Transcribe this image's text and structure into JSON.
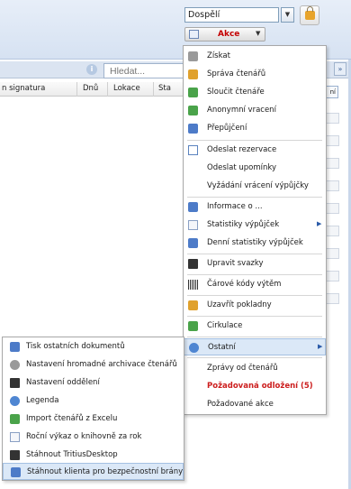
{
  "header": {
    "age_select_value": "Dospělí",
    "actions_button_label": "Akce",
    "actions_button_color": "#c40000"
  },
  "search": {
    "placeholder": "Hledat..."
  },
  "table": {
    "columns": [
      "n signatura",
      "Dnů",
      "Lokace",
      "Sta"
    ]
  },
  "right_panel": {
    "tab_label": "ní"
  },
  "actions_menu": {
    "items": [
      {
        "label": "Získat",
        "icon": "acquire-icon"
      },
      {
        "label": "Správa čtenářů",
        "icon": "readers-icon"
      },
      {
        "label": "Sloučit čtenáře",
        "icon": "merge-readers-icon"
      },
      {
        "label": "Anonymní vracení",
        "icon": "anonymous-return-icon"
      },
      {
        "label": "Přepůjčení",
        "icon": "reloan-icon"
      },
      {
        "label": "Odeslat rezervace",
        "icon": "mail-icon"
      },
      {
        "label": "Odeslat upomínky",
        "icon": ""
      },
      {
        "label": "Vyžádání vrácení výpůjčky",
        "icon": ""
      },
      {
        "label": "Informace o ...",
        "icon": "print-icon"
      },
      {
        "label": "Statistiky výpůjček",
        "icon": "document-icon",
        "has_submenu": true
      },
      {
        "label": "Denní statistiky výpůjček",
        "icon": "calendar-icon"
      },
      {
        "label": "Upravit svazky",
        "icon": "edit-volumes-icon"
      },
      {
        "label": "Čárové kódy výtěm",
        "icon": "barcode-icon"
      },
      {
        "label": "Uzavřít pokladny",
        "icon": "lock-icon"
      },
      {
        "label": "Cirkulace",
        "icon": "circulation-icon"
      },
      {
        "label": "Ostatní",
        "icon": "info-icon",
        "has_submenu": true,
        "highlighted": true
      },
      {
        "label": "Zprávy od čtenářů",
        "icon": ""
      },
      {
        "label": "Požadovaná odložení (5)",
        "icon": "",
        "emphasis": true
      },
      {
        "label": "Požadované akce",
        "icon": ""
      }
    ]
  },
  "other_submenu": {
    "items": [
      {
        "label": "Tisk ostatních dokumentů",
        "icon": "print-icon"
      },
      {
        "label": "Nastavení hromadné archivace čtenářů",
        "icon": "gear-icon"
      },
      {
        "label": "Nastavení oddělení",
        "icon": "home-icon"
      },
      {
        "label": "Legenda",
        "icon": "help-icon"
      },
      {
        "label": "Import čtenářů z Excelu",
        "icon": "excel-icon"
      },
      {
        "label": "Roční výkaz o knihovně za rok",
        "icon": "report-icon"
      },
      {
        "label": "Stáhnout TritiusDesktop",
        "icon": "terminal-icon"
      },
      {
        "label": "Stáhnout klienta pro bezpečnostní brány",
        "icon": "download-icon",
        "highlighted": true
      }
    ]
  },
  "colors": {
    "highlight_bg": "#dbe8f7",
    "emphasis_text": "#cc1d1d",
    "header_bg": "#d6e2f2"
  }
}
